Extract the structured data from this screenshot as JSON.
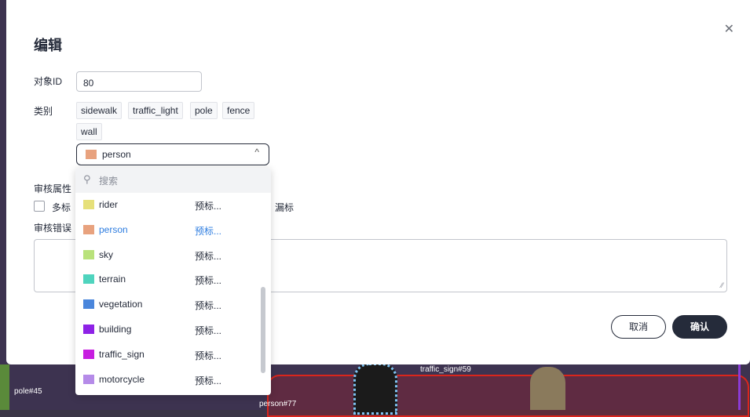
{
  "dialog": {
    "title": "编辑",
    "close_glyph": "✕",
    "object_id_label": "对象ID",
    "object_id_value": "80",
    "category_label": "类别",
    "category_tags": [
      "sidewalk",
      "traffic_light",
      "pole",
      "fence",
      "wall"
    ],
    "select": {
      "value": "person",
      "color": "#e8a27e",
      "chevron": "^"
    },
    "review_attr_label": "审核属性",
    "checkbox_left_label": "多标",
    "checkbox_right_label": "漏标",
    "review_error_label": "审核错误",
    "cancel_label": "取消",
    "confirm_label": "确认"
  },
  "dropdown": {
    "search_placeholder": "搜索",
    "options": [
      {
        "name": "rider",
        "pre": "预标...",
        "color": "#e6e07a",
        "selected": false
      },
      {
        "name": "person",
        "pre": "预标...",
        "color": "#e8a27e",
        "selected": true
      },
      {
        "name": "sky",
        "pre": "预标...",
        "color": "#b9e27b",
        "selected": false
      },
      {
        "name": "terrain",
        "pre": "预标...",
        "color": "#4fd4be",
        "selected": false
      },
      {
        "name": "vegetation",
        "pre": "预标...",
        "color": "#4a86dc",
        "selected": false
      },
      {
        "name": "building",
        "pre": "预标...",
        "color": "#8e22e6",
        "selected": false
      },
      {
        "name": "traffic_sign",
        "pre": "预标...",
        "color": "#c71ee0",
        "selected": false
      },
      {
        "name": "motorcycle",
        "pre": "预标...",
        "color": "#b58be8",
        "selected": false
      }
    ]
  },
  "background_labels": {
    "pole": "pole#45",
    "person": "person#77",
    "traffic_sign": "traffic_sign#59"
  }
}
